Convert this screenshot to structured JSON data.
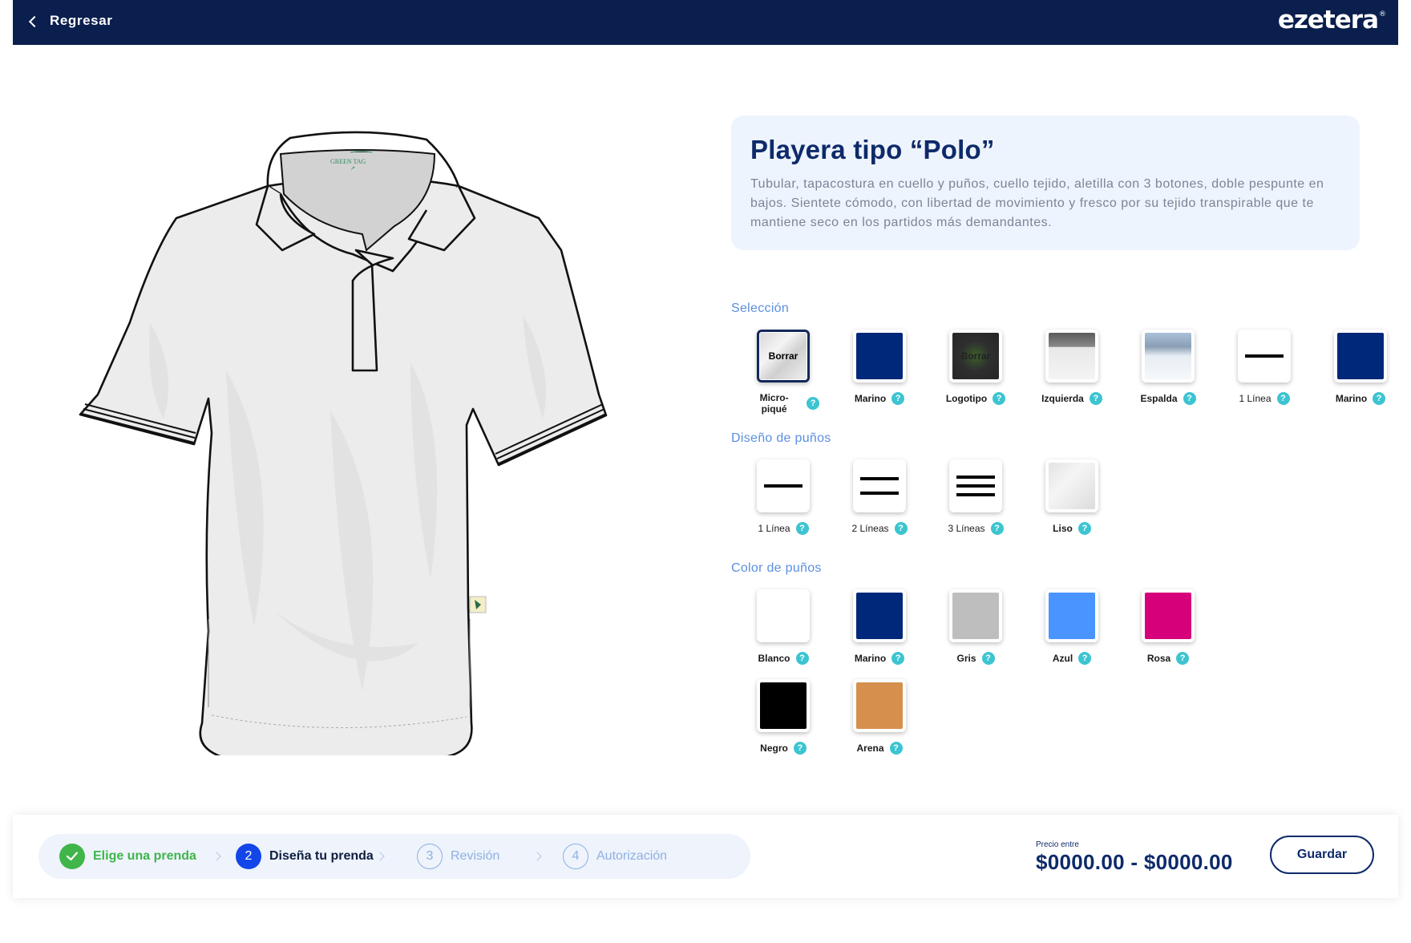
{
  "header": {
    "back_label": "Regresar",
    "logo_text": "ezetera",
    "logo_mark": "®"
  },
  "garment": {
    "tag_brand": "GREEN TAG"
  },
  "product": {
    "title": "Playera tipo “Polo”",
    "description": "Tubular, tapacostura en cuello y puños, cuello tejido, aletilla con 3 botones, doble pespunte en bajos. Sientete cómodo, con libertad de movimiento y fresco por su tejido transpirable que te mantiene seco en los partidos más demandantes."
  },
  "seleccion": {
    "title": "Selección",
    "items": [
      {
        "label": "Micro-piqué",
        "badge": "Borrar",
        "help": "?"
      },
      {
        "label": "Marino",
        "color": "#00287a",
        "help": "?"
      },
      {
        "label": "Logotipo",
        "badge": "Borrar",
        "help": "?"
      },
      {
        "label": "Izquierda",
        "help": "?"
      },
      {
        "label": "Espalda",
        "help": "?"
      },
      {
        "label": "1 Línea",
        "help": "?"
      },
      {
        "label": "Marino",
        "color": "#00287a",
        "help": "?"
      }
    ]
  },
  "cuff_design": {
    "title": "Diseño de puños",
    "items": [
      {
        "label": "1 Línea",
        "lines": 1,
        "help": "?"
      },
      {
        "label": "2 Líneas",
        "lines": 2,
        "help": "?"
      },
      {
        "label": "3 Líneas",
        "lines": 3,
        "help": "?"
      },
      {
        "label": "Liso",
        "lines": 0,
        "help": "?"
      }
    ]
  },
  "cuff_color": {
    "title": "Color de puños",
    "items": [
      {
        "label": "Blanco",
        "color": "#ffffff",
        "help": "?"
      },
      {
        "label": "Marino",
        "color": "#00287a",
        "help": "?"
      },
      {
        "label": "Gris",
        "color": "#bebebe",
        "help": "?"
      },
      {
        "label": "Azul",
        "color": "#4a94ff",
        "help": "?"
      },
      {
        "label": "Rosa",
        "color": "#d6007a",
        "help": "?"
      },
      {
        "label": "Negro",
        "color": "#000000",
        "help": "?"
      },
      {
        "label": "Arena",
        "color": "#d4904c",
        "help": "?"
      }
    ]
  },
  "steps": [
    {
      "number": "✓",
      "label": "Elige una prenda",
      "state": "done"
    },
    {
      "number": "2",
      "label": "Diseña tu prenda",
      "state": "active"
    },
    {
      "number": "3",
      "label": "Revisión",
      "state": "pending"
    },
    {
      "number": "4",
      "label": "Autorización",
      "state": "pending"
    }
  ],
  "price": {
    "label": "Precio entre",
    "range": "$0000.00 - $0000.00"
  },
  "save_label": "Guardar"
}
